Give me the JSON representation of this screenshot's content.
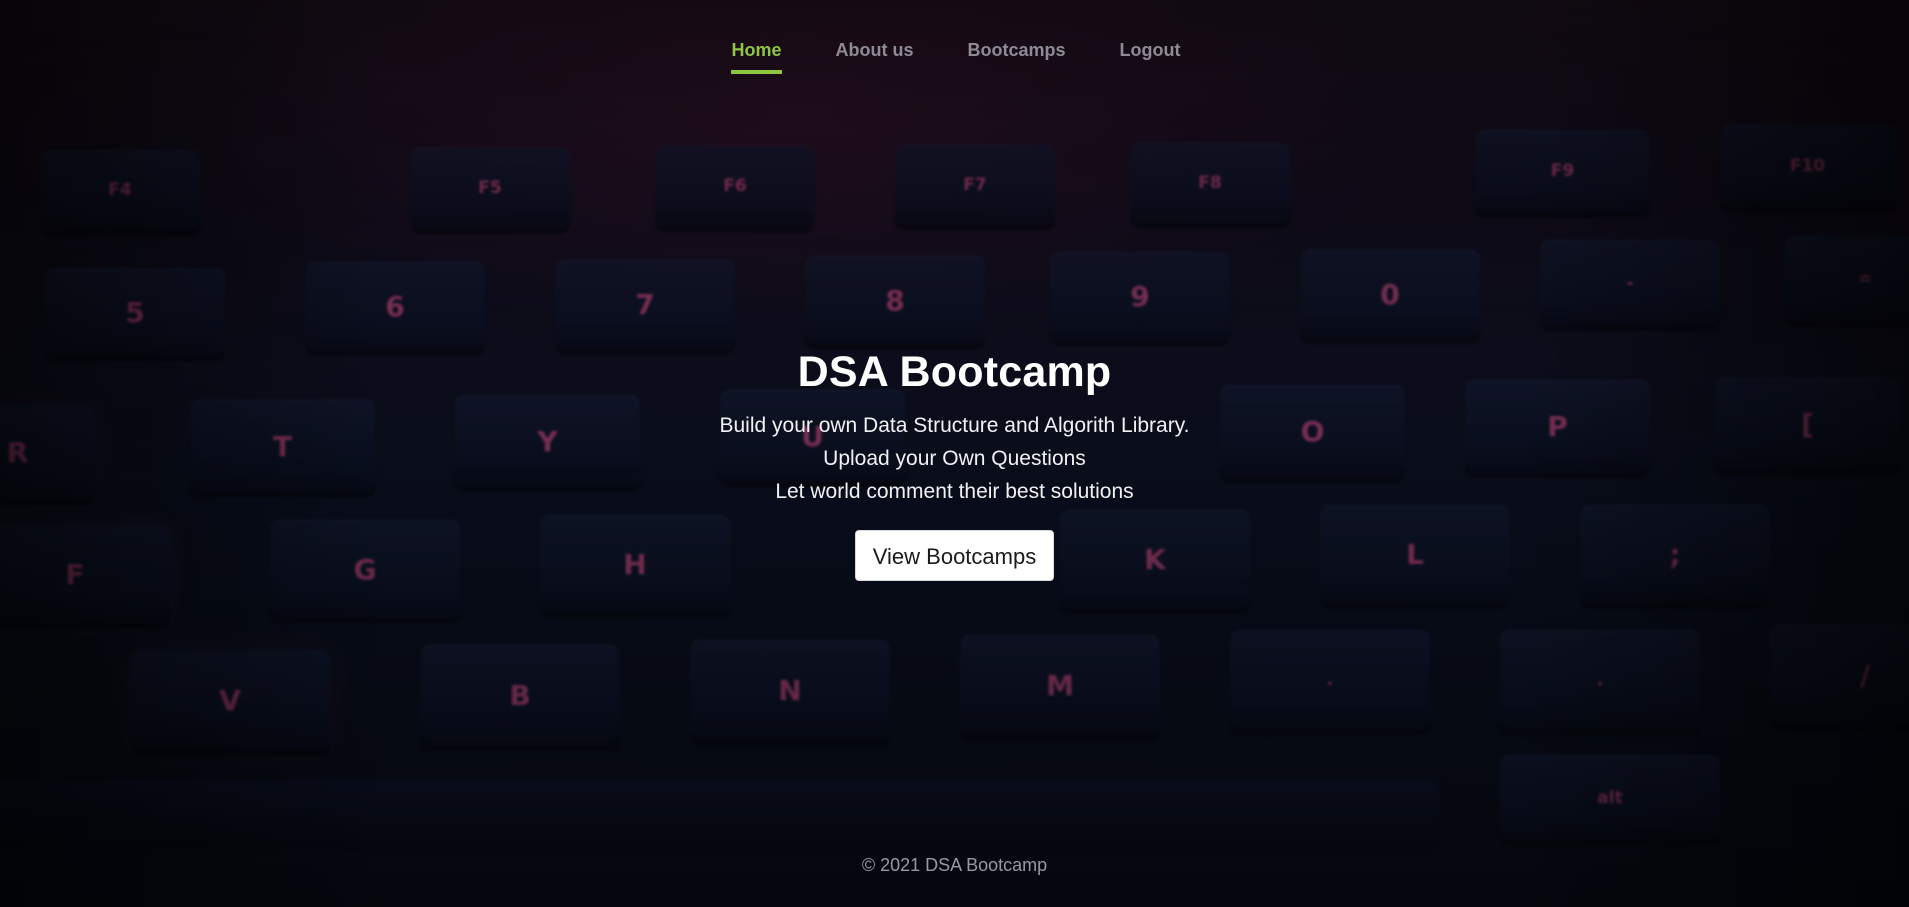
{
  "nav": {
    "items": [
      {
        "label": "Home",
        "active": true
      },
      {
        "label": "About us",
        "active": false
      },
      {
        "label": "Bootcamps",
        "active": false
      },
      {
        "label": "Logout",
        "active": false
      }
    ]
  },
  "hero": {
    "title": "DSA Bootcamp",
    "lines": [
      "Build your own Data Structure and Algorith Library.",
      "Upload your Own Questions",
      "Let world comment their best solutions"
    ],
    "cta_label": "View Bootcamps"
  },
  "background": {
    "keyboard_legends": {
      "row_f": [
        "F4",
        "F5",
        "F6",
        "F7",
        "F8",
        "F9",
        "F10"
      ],
      "row_num": [
        "5",
        "6",
        "7",
        "8",
        "9",
        "0",
        "-",
        "="
      ],
      "row_top": [
        "R",
        "T",
        "Y",
        "U",
        "O",
        "P",
        "["
      ],
      "row_home": [
        "F",
        "G",
        "H",
        "K",
        "L",
        ";"
      ],
      "row_bottom": [
        "V",
        "B",
        "N",
        "M",
        ".",
        ".",
        "/"
      ],
      "row_space": [
        "alt"
      ]
    }
  },
  "footer": {
    "text": "© 2021 DSA Bootcamp"
  },
  "colors": {
    "accent": "#8ec63f",
    "nav_inactive": "#8e8b94",
    "key_legend": "#c2487d"
  }
}
